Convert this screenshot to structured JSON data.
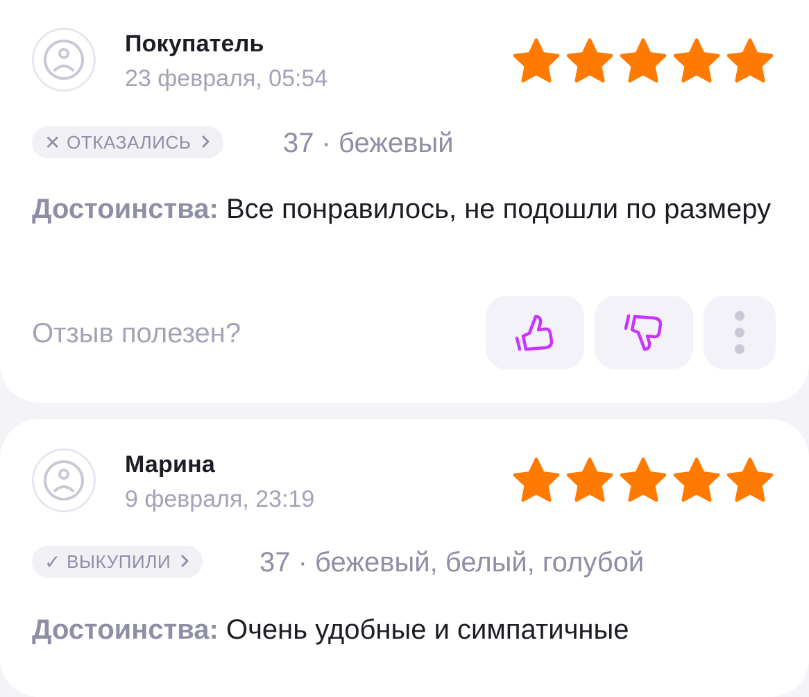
{
  "reviews": [
    {
      "author": "Покупатель",
      "date": "23 февраля, 05:54",
      "rating": 5,
      "status_mark": "✕",
      "status": "ОТКАЗАЛИСЬ",
      "variant": "37 · бежевый",
      "pros_label": "Достоинства:",
      "pros_text": " Все понравилось, не подошли по размеру",
      "helpful_question": "Отзыв полезен?"
    },
    {
      "author": "Марина",
      "date": "9 февраля, 23:19",
      "rating": 5,
      "status_mark": "✓",
      "status": "ВЫКУПИЛИ",
      "variant": "37 · бежевый, белый, голубой",
      "pros_label": "Достоинства:",
      "pros_text": " Очень удобные и симпатичные"
    }
  ],
  "icons": {
    "avatar": "sad-face-icon",
    "star": "star-icon",
    "like": "thumbs-up-icon",
    "dislike": "thumbs-down-icon",
    "more": "more-vertical-icon",
    "chevron": "chevron-right-icon"
  },
  "colors": {
    "star": "#ff7a00",
    "vote_icon": "#c733ff",
    "muted_text": "#8e8ea6",
    "background": "#f4f4f8"
  }
}
